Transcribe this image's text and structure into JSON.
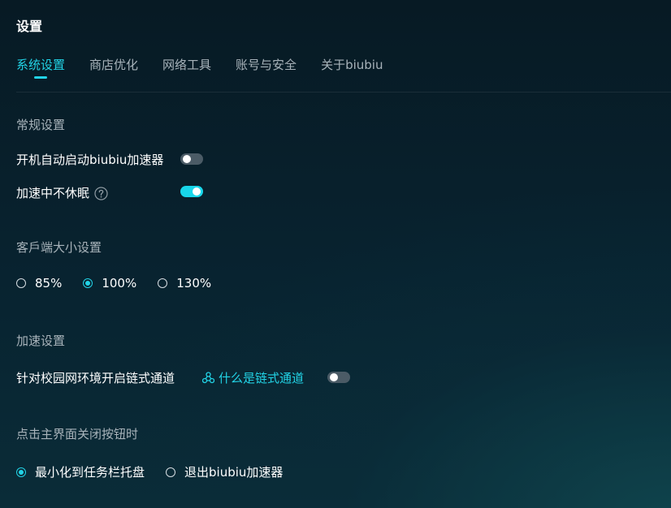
{
  "header": {
    "title": "设置"
  },
  "tabs": [
    {
      "label": "系统设置",
      "active": true
    },
    {
      "label": "商店优化",
      "active": false
    },
    {
      "label": "网络工具",
      "active": false
    },
    {
      "label": "账号与安全",
      "active": false
    },
    {
      "label": "关于biubiu",
      "active": false
    }
  ],
  "general": {
    "title": "常规设置",
    "autostart": {
      "label": "开机自动启动biubiu加速器",
      "enabled": false
    },
    "no_sleep": {
      "label": "加速中不休眠",
      "enabled": true,
      "help_icon": "question-circle-icon"
    }
  },
  "client_size": {
    "title": "客戶端大小设置",
    "options": [
      "85%",
      "100%",
      "130%"
    ],
    "selected": "100%"
  },
  "acceleration": {
    "title": "加速设置",
    "campus_chain": {
      "label": "针对校园网环境开启链式通道",
      "enabled": false
    },
    "chain_link": {
      "label": "什么是链式通道",
      "icon": "chain-nodes-icon"
    }
  },
  "close_action": {
    "title": "点击主界面关闭按钮时",
    "options": [
      "最小化到任务栏托盘",
      "退出biubiu加速器"
    ],
    "selected": "最小化到任务栏托盘"
  },
  "colors": {
    "accent": "#22d3e6",
    "toggle_off": "#4b5b66",
    "muted_text": "#a8b3ba"
  }
}
